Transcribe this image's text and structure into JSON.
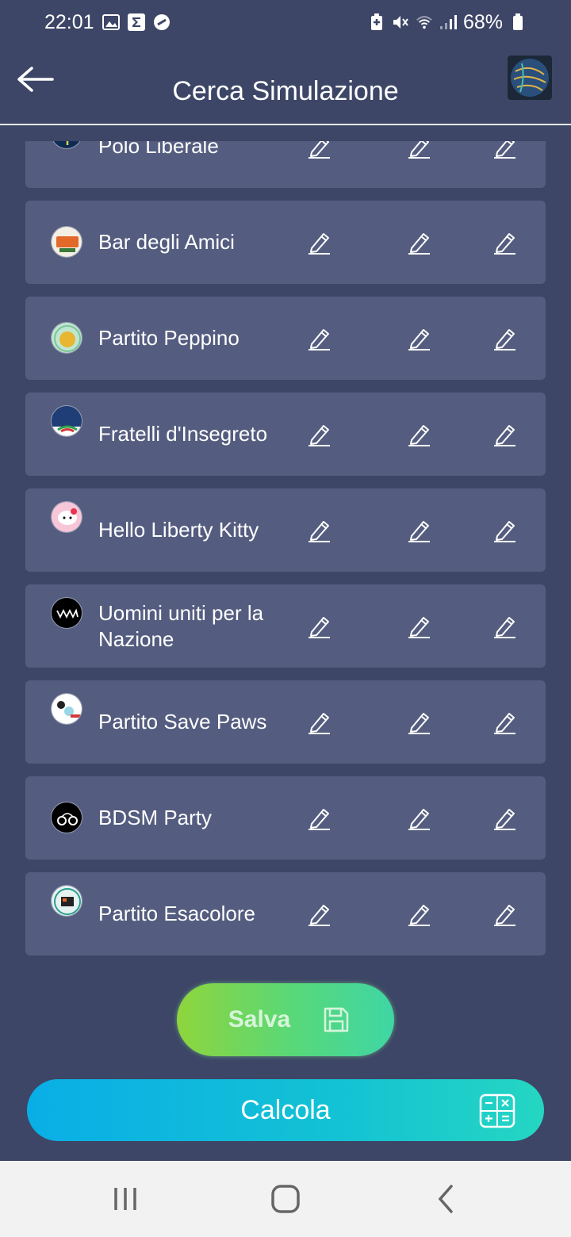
{
  "status_bar": {
    "time": "22:01",
    "battery": "68%"
  },
  "header": {
    "title": "Cerca Simulazione"
  },
  "parties": [
    {
      "name": "Polo Liberale",
      "logo": "polo-liberale-logo"
    },
    {
      "name": "Bar degli Amici",
      "logo": "bar-degli-amici-logo"
    },
    {
      "name": "Partito Peppino",
      "logo": "partito-peppino-logo"
    },
    {
      "name": "Fratelli d'Insegreto",
      "logo": "fratelli-insegreto-logo"
    },
    {
      "name": "Hello Liberty Kitty",
      "logo": "hello-liberty-kitty-logo"
    },
    {
      "name": "Uomini uniti per la Nazione",
      "logo": "uomini-uniti-logo"
    },
    {
      "name": "Partito Save Paws",
      "logo": "save-paws-logo"
    },
    {
      "name": "BDSM Party",
      "logo": "bdsm-party-logo"
    },
    {
      "name": "Partito Esacolore",
      "logo": "esacolore-logo"
    }
  ],
  "actions": {
    "save_label": "Salva",
    "calc_label": "Calcola"
  },
  "icons": {
    "edit": "pencil-icon",
    "back": "arrow-left-icon",
    "save": "floppy-disk-icon",
    "calc": "calculator-icon"
  },
  "colors": {
    "background": "#3d4666",
    "row": "#545d7f",
    "save_start": "#8fd53c",
    "save_end": "#3fd6a5",
    "calc_start": "#0aaee6",
    "calc_end": "#25d6c2"
  }
}
